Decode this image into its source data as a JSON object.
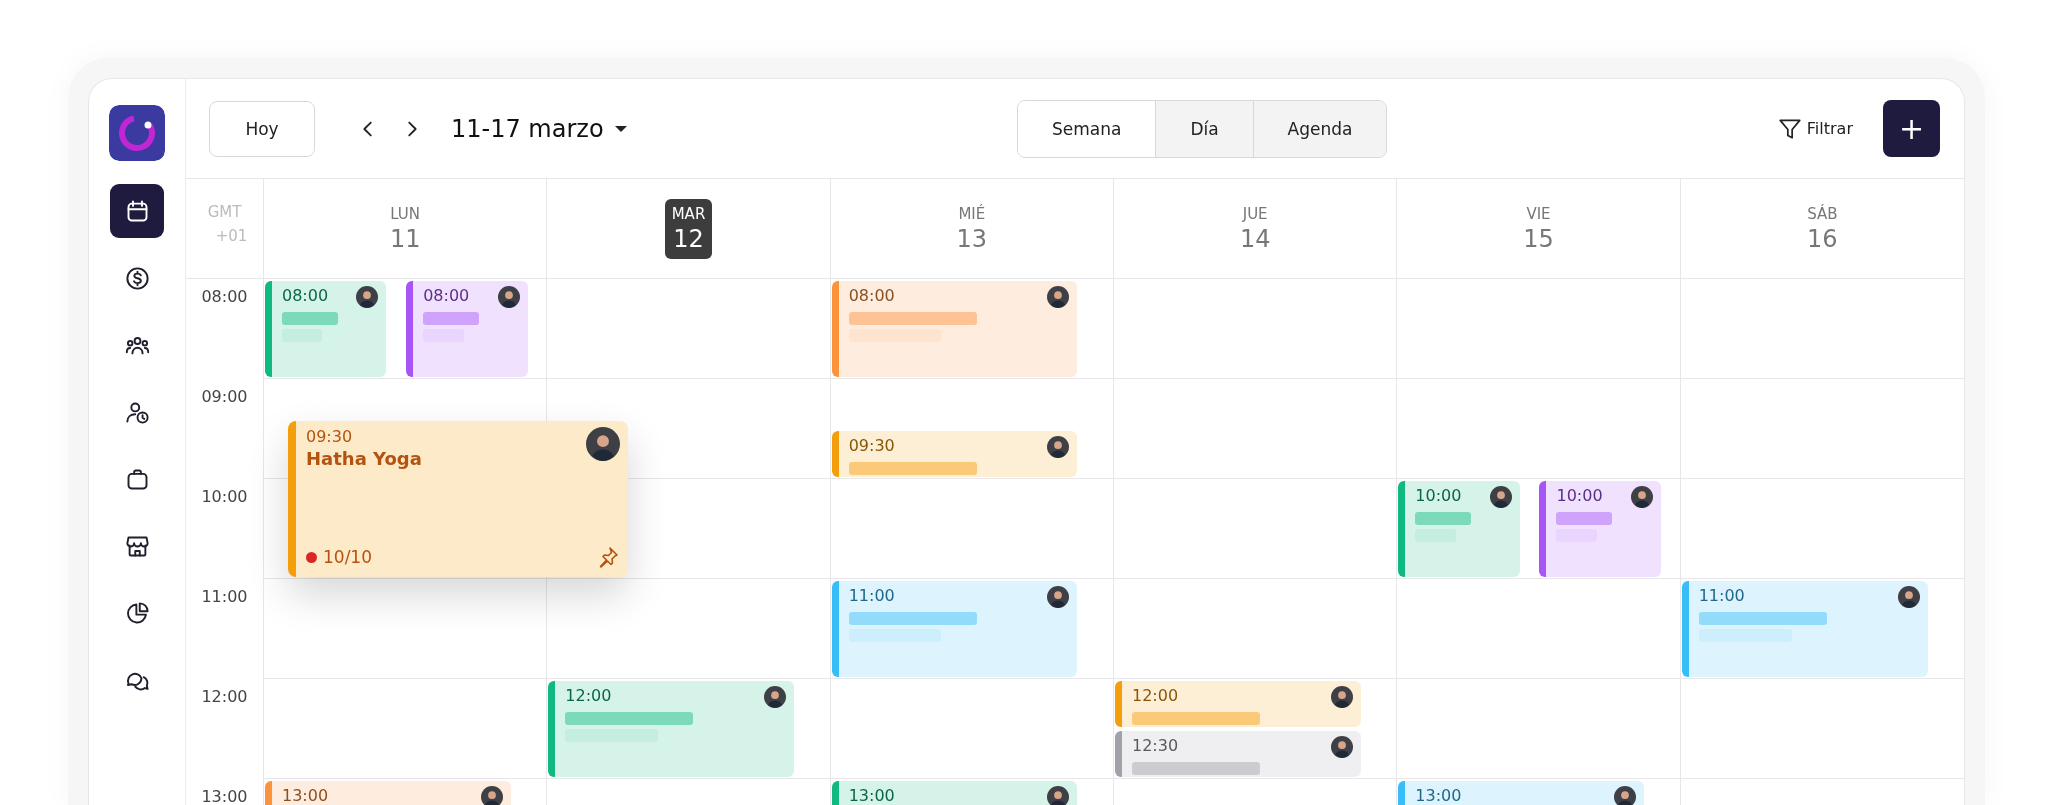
{
  "sidebar": {
    "items": [
      {
        "selected": true
      },
      {
        "selected": false
      },
      {
        "selected": false
      },
      {
        "selected": false
      },
      {
        "selected": false
      },
      {
        "selected": false
      },
      {
        "selected": false
      },
      {
        "selected": false
      }
    ]
  },
  "toolbar": {
    "today_button": "Hoy",
    "range_title": "11-17 marzo",
    "views": [
      {
        "label": "Semana",
        "selected": true
      },
      {
        "label": "Día",
        "selected": false
      },
      {
        "label": "Agenda",
        "selected": false
      }
    ],
    "filter_button": "Filtrar",
    "add_button": "+"
  },
  "timezone": [
    "GMT",
    "+01"
  ],
  "hours": [
    "08:00",
    "09:00",
    "10:00",
    "11:00",
    "12:00",
    "13:00"
  ],
  "days": [
    {
      "label": "LUN",
      "number": "11",
      "selected": false,
      "events": [
        {
          "time": "08:00",
          "kind": "long",
          "color": "#10b981"
        },
        {
          "time": "08:00",
          "kind": "long",
          "color": "#a855f7"
        },
        {
          "time": "13:00",
          "kind": "long",
          "color": "#fb923c"
        }
      ],
      "popover": {
        "time": "09:30",
        "title": "Hatha Yoga",
        "count": "10/10",
        "color": "#f59e0b"
      }
    },
    {
      "label": "MAR",
      "number": "12",
      "selected": true,
      "events": [
        {
          "time": "12:00",
          "kind": "long",
          "color": "#10b981"
        }
      ]
    },
    {
      "label": "MIÉ",
      "number": "13",
      "selected": false,
      "events": [
        {
          "time": "08:00",
          "kind": "long",
          "color": "#fb923c"
        },
        {
          "time": "09:30",
          "kind": "short",
          "color": "#f59e0b"
        },
        {
          "time": "11:00",
          "kind": "long",
          "color": "#38bdf8"
        },
        {
          "time": "13:00",
          "kind": "long",
          "color": "#10b981"
        }
      ]
    },
    {
      "label": "JUE",
      "number": "14",
      "selected": false,
      "events": [
        {
          "time": "12:00",
          "kind": "short",
          "color": "#f59e0b"
        },
        {
          "time": "12:30",
          "kind": "short",
          "color": "#a1a1aa"
        }
      ]
    },
    {
      "label": "VIE",
      "number": "15",
      "selected": false,
      "events": [
        {
          "time": "10:00",
          "kind": "long",
          "color": "#10b981"
        },
        {
          "time": "10:00",
          "kind": "long",
          "color": "#a855f7"
        },
        {
          "time": "13:00",
          "kind": "long",
          "color": "#38bdf8"
        }
      ]
    },
    {
      "label": "SÁB",
      "number": "16",
      "selected": false,
      "events": [
        {
          "time": "11:00",
          "kind": "long",
          "color": "#38bdf8"
        }
      ]
    }
  ]
}
